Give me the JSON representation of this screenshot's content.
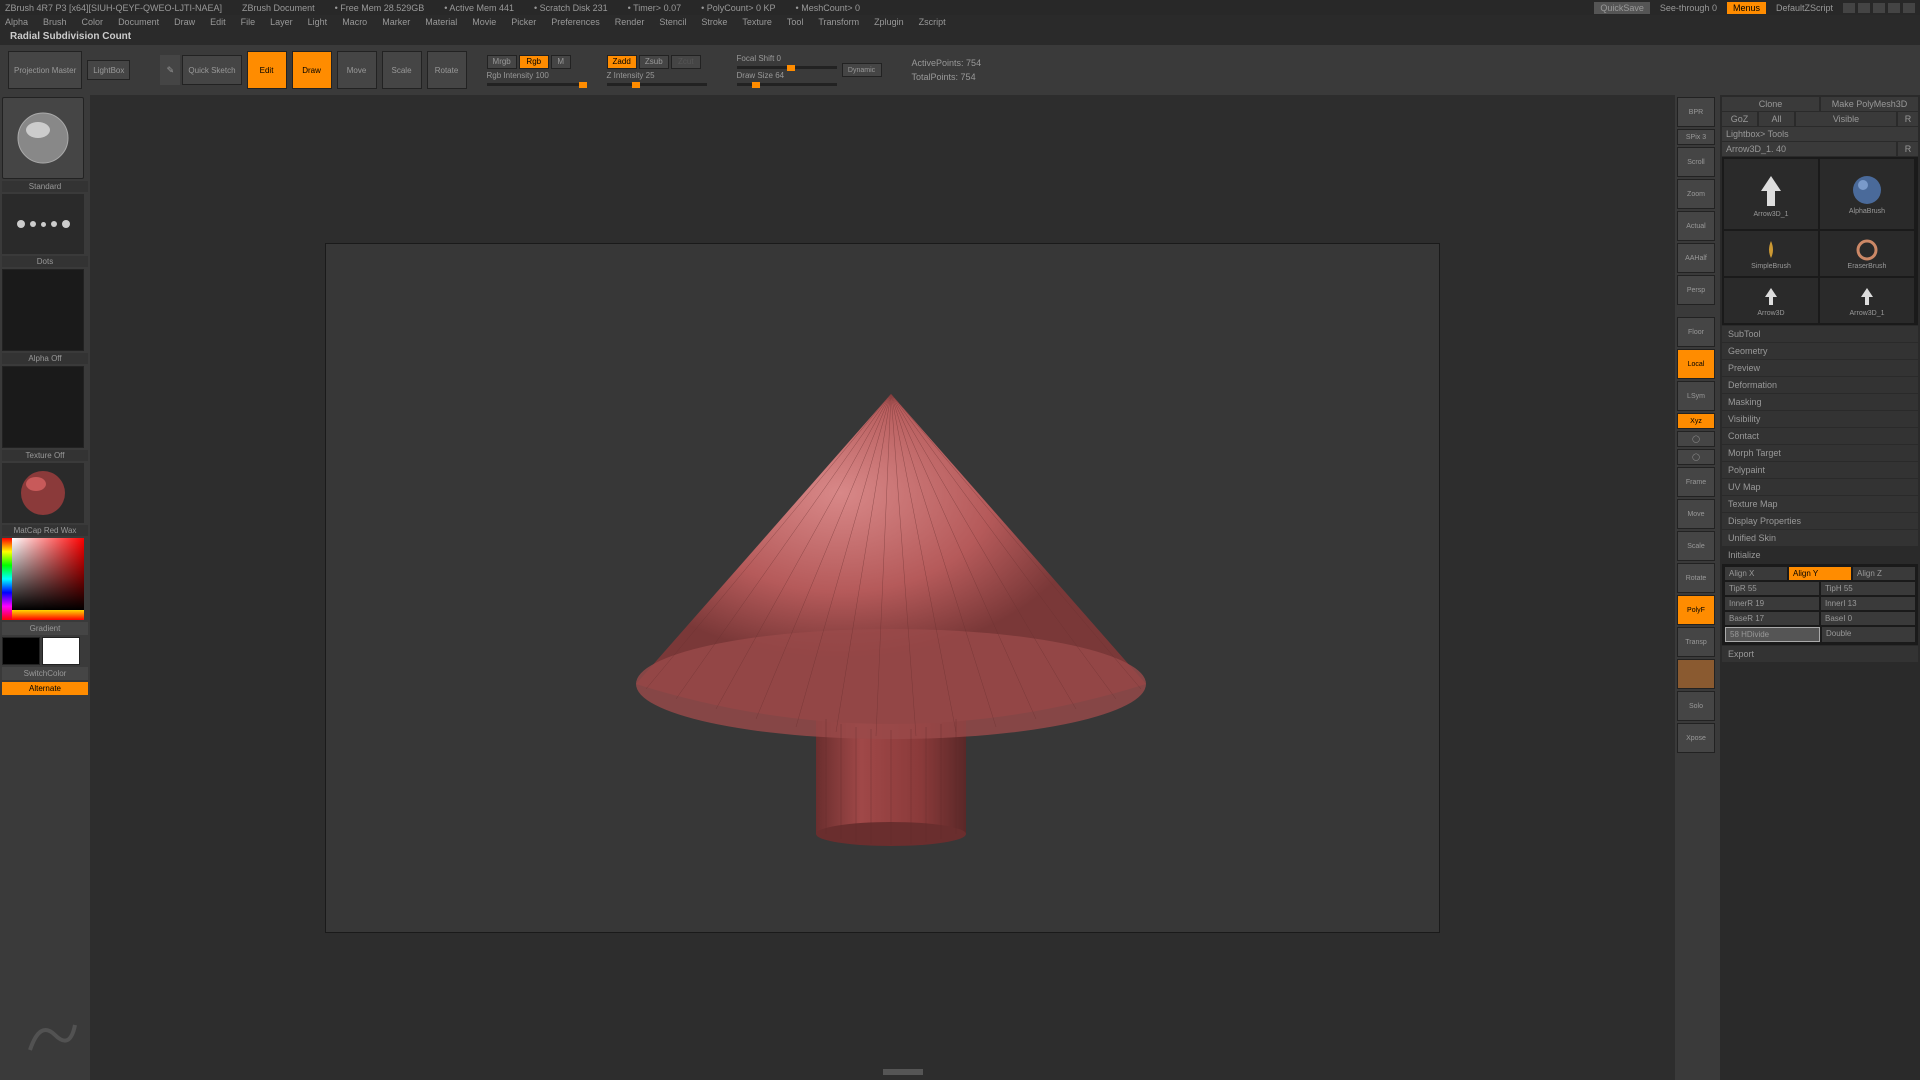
{
  "titlebar": {
    "app": "ZBrush 4R7 P3 [x64][SIUH-QEYF-QWEO-LJTI-NAEA]",
    "doc": "ZBrush Document",
    "freemem": "• Free Mem 28.529GB",
    "activemem": "• Active Mem 441",
    "scratch": "• Scratch Disk 231",
    "timer": "• Timer> 0.07",
    "polycount": "• PolyCount> 0 KP",
    "meshcount": "• MeshCount> 0",
    "quicksave": "QuickSave",
    "seethrough": "See-through  0",
    "menus": "Menus",
    "script": "DefaultZScript"
  },
  "menubar": [
    "Alpha",
    "Brush",
    "Color",
    "Document",
    "Draw",
    "Edit",
    "File",
    "Layer",
    "Light",
    "Macro",
    "Marker",
    "Material",
    "Movie",
    "Picker",
    "Preferences",
    "Render",
    "Stencil",
    "Stroke",
    "Texture",
    "Tool",
    "Transform",
    "Zplugin",
    "Zscript"
  ],
  "status": "Radial Subdivision Count",
  "toolbar": {
    "projection": "Projection\nMaster",
    "lightbox": "LightBox",
    "quicksketch": "Quick\nSketch",
    "edit": "Edit",
    "draw": "Draw",
    "move": "Move",
    "scale": "Scale",
    "rotate": "Rotate",
    "mrgb": "Mrgb",
    "rgb": "Rgb",
    "m": "M",
    "rgbint": "Rgb Intensity 100",
    "zadd": "Zadd",
    "zsub": "Zsub",
    "zcut": "Zcut",
    "zint": "Z Intensity 25",
    "focal": "Focal Shift 0",
    "drawsize": "Draw Size 64",
    "dynamic": "Dynamic",
    "active": "ActivePoints: 754",
    "total": "TotalPoints: 754"
  },
  "left": {
    "brush": "Standard",
    "stroke": "Dots",
    "alpha": "Alpha Off",
    "texture": "Texture Off",
    "material": "MatCap Red Wax",
    "gradient": "Gradient",
    "switchcolor": "SwitchColor",
    "alternate": "Alternate"
  },
  "dock": {
    "bpr": "BPR",
    "spix": "SPix 3",
    "scroll": "Scroll",
    "zoom": "Zoom",
    "actual": "Actual",
    "aahalf": "AAHalf",
    "persp": "Persp",
    "floor": "Floor",
    "local": "Local",
    "lsym": "LSym",
    "xyz": "Xyz",
    "frame": "Frame",
    "move": "Move",
    "scale": "Scale",
    "rotate": "Rotate",
    "polyf": "PolyF",
    "transp": "Transp",
    "solo": "Solo",
    "xpose": "Xpose"
  },
  "right": {
    "clone": "Clone",
    "makepoly": "Make PolyMesh3D",
    "goz": "GoZ",
    "all": "All",
    "visible": "Visible",
    "r": "R",
    "lightboxtools": "Lightbox> Tools",
    "toolname": "Arrow3D_1. 40",
    "tools": [
      {
        "name": "Arrow3D_1"
      },
      {
        "name": "AlphaBrush"
      },
      {
        "name": "SimpleBrush"
      },
      {
        "name": "EraserBrush"
      },
      {
        "name": "Arrow3D"
      },
      {
        "name": "Arrow3D_1"
      }
    ],
    "sections": [
      "SubTool",
      "Geometry",
      "Preview",
      "Deformation",
      "Masking",
      "Visibility",
      "Contact",
      "Morph Target",
      "Polypaint",
      "UV Map",
      "Texture Map",
      "Display Properties",
      "Unified Skin",
      "Initialize",
      "Export"
    ],
    "init": {
      "alignx": "Align X",
      "aligny": "Align Y",
      "alignz": "Align Z",
      "tipr": "TipR 55",
      "tiph": "TipH 55",
      "innerr": "InnerR 19",
      "inneri": "InnerI 13",
      "baser": "BaseR 17",
      "basei": "BaseI 0",
      "hdivide": "58 HDivide",
      "double": "Double"
    }
  },
  "chart_data": null
}
